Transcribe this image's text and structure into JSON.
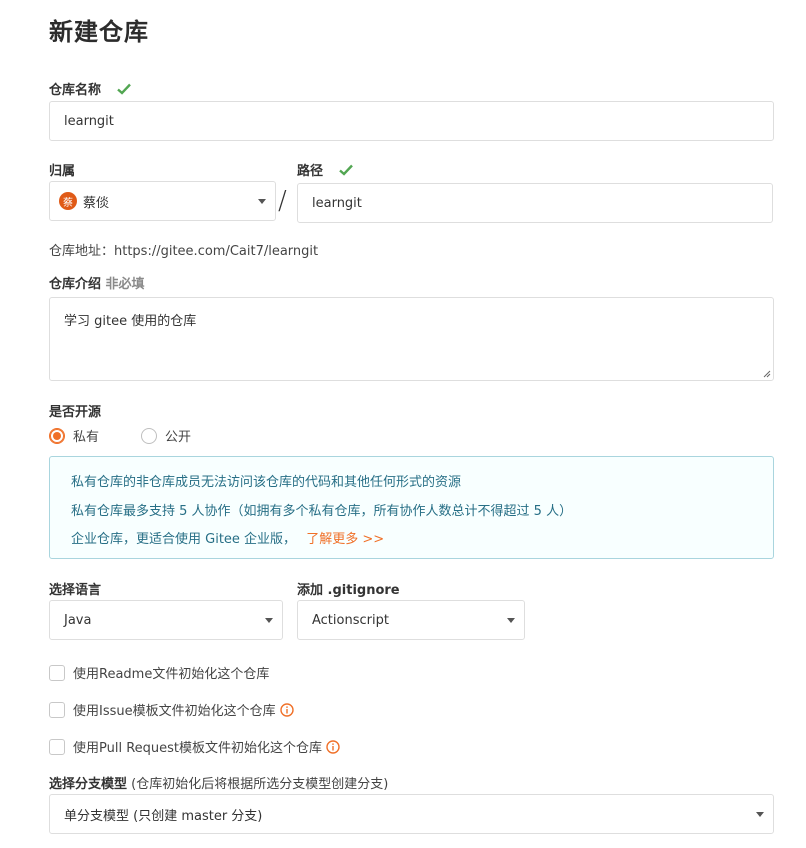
{
  "page": {
    "title": "新建仓库"
  },
  "repo_name": {
    "label": "仓库名称",
    "value": "learngit"
  },
  "owner": {
    "label": "归属",
    "avatar_text": "蔡",
    "value": "蔡倓"
  },
  "path": {
    "label": "路径",
    "separator": "/",
    "value": "learngit"
  },
  "repo_address": {
    "text": "仓库地址：https://gitee.com/Cait7/learngit"
  },
  "intro": {
    "label": "仓库介绍",
    "optional": "非必填",
    "value": "学习 gitee 使用的仓库"
  },
  "visibility": {
    "label": "是否开源",
    "options": [
      {
        "label": "私有",
        "selected": true
      },
      {
        "label": "公开",
        "selected": false
      }
    ]
  },
  "notice": {
    "line1": "私有仓库的非仓库成员无法访问该仓库的代码和其他任何形式的资源",
    "line2": "私有仓库最多支持 5 人协作（如拥有多个私有仓库，所有协作人数总计不得超过 5 人）",
    "line3": "企业仓库，更适合使用 Gitee 企业版，",
    "link": "了解更多 >>"
  },
  "language": {
    "label": "选择语言",
    "value": "Java"
  },
  "gitignore": {
    "label": "添加 .gitignore",
    "value": "Actionscript"
  },
  "init_options": [
    {
      "label": "使用Readme文件初始化这个仓库",
      "checked": false,
      "info": false
    },
    {
      "label": "使用Issue模板文件初始化这个仓库",
      "checked": false,
      "info": true
    },
    {
      "label": "使用Pull Request模板文件初始化这个仓库",
      "checked": false,
      "info": true
    }
  ],
  "branch_model": {
    "label": "选择分支模型",
    "hint": "(仓库初始化后将根据所选分支模型创建分支)",
    "value": "单分支模型 (只创建 master 分支)"
  },
  "colors": {
    "accent": "#f07028",
    "success": "#52a652",
    "notice_text": "#276f86",
    "notice_border": "#a9d5de"
  }
}
